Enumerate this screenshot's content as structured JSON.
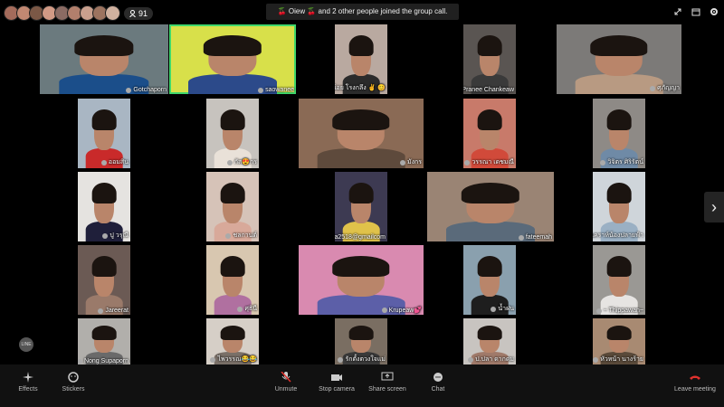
{
  "header": {
    "participant_count": "91",
    "notice_prefix": "Oiew",
    "notice_suffix": "and 2 other people joined the group call.",
    "avatars": [
      "#a46b5b",
      "#c18872",
      "#7b5846",
      "#d29a85",
      "#8b6b63",
      "#b27f6c",
      "#c9a08e",
      "#9c735f",
      "#d0b19f"
    ]
  },
  "tiles": [
    {
      "id": "t1",
      "name": "Gotchaporn",
      "bg": "#6b7a7e",
      "shirt": "#1b4e8a"
    },
    {
      "id": "t2",
      "name": "saowanee",
      "bg": "#d8e04a",
      "shirt": "#2c4a8a",
      "active": true
    },
    {
      "id": "t3",
      "name": "เจนน้อย โรงกลึง ✌ 😊",
      "bg": "#b9a9a0",
      "shirt": "#2b2b2b"
    },
    {
      "id": "t4",
      "name": "Pranee Chankeaw",
      "bg": "#5a5552",
      "shirt": "#3a3a3a"
    },
    {
      "id": "t5",
      "name": "ศุภัญญา",
      "bg": "#7c7a78",
      "shirt": "#b89a82"
    },
    {
      "id": "t6",
      "name": "ออมสิน",
      "bg": "#a9b6c3",
      "shirt": "#c92a2a"
    },
    {
      "id": "t7",
      "name": "กัส😍กร",
      "bg": "#c7c3be",
      "shirt": "#e9e1d8"
    },
    {
      "id": "t8",
      "name": "มังกร",
      "bg": "#8a6a55",
      "shirt": "#5e4a3c"
    },
    {
      "id": "t9",
      "name": "วรรณา เดชมณี",
      "bg": "#c87a6a",
      "shirt": "#d14a3a"
    },
    {
      "id": "t10",
      "name": "วิจิตร ศิริรัตน์",
      "bg": "#8e8a86",
      "shirt": "#6f8aa6"
    },
    {
      "id": "t11",
      "name": "ปู วรุณี",
      "bg": "#e5e3e0",
      "shirt": "#1f1f3a"
    },
    {
      "id": "t12",
      "name": "ชลกานต์",
      "bg": "#d6c3b8",
      "shirt": "#d8a99a"
    },
    {
      "id": "t13",
      "name": "Kochana2518@gmailcom",
      "bg": "#3d3a52",
      "shirt": "#e0c24a"
    },
    {
      "id": "t14",
      "name": "fateemah",
      "bg": "#9a8474",
      "shirt": "#5a6a7a"
    },
    {
      "id": "t15",
      "name": "ชมนคราห์น้องปลายฟ้า",
      "bg": "#cfd5da",
      "shirt": "#9ab0c4"
    },
    {
      "id": "t16",
      "name": "Jareerat",
      "bg": "#6b5a54",
      "shirt": "#9a7a6a"
    },
    {
      "id": "t17",
      "name": "ศุธินี",
      "bg": "#d8c7b0",
      "shirt": "#b070a0"
    },
    {
      "id": "t18",
      "name": "Krupeaw💕",
      "bg": "#d98ab0",
      "shirt": "#5c5fa8"
    },
    {
      "id": "t19",
      "name": "น้ำฝน",
      "bg": "#8aa0ae",
      "shirt": "#1e1e1e"
    },
    {
      "id": "t20",
      "name": "~ Thippawan~",
      "bg": "#9a9894",
      "shirt": "#e6e4e2"
    },
    {
      "id": "t21",
      "name": "Nong Supaporn",
      "bg": "#b1afab",
      "shirt": "#6a6a6a"
    },
    {
      "id": "t22",
      "name": "ไพวรรณ😂😂",
      "bg": "#d6cfc7",
      "shirt": "#7a7068"
    },
    {
      "id": "t23",
      "name": "รักตั้งตวงใจแม่",
      "bg": "#7a6e62",
      "shirt": "#3a3a3a"
    },
    {
      "id": "t24",
      "name": "ป.ปลา ดากดม",
      "bg": "#c8c4c0",
      "shirt": "#a07a6a"
    },
    {
      "id": "t25",
      "name": "หัวหน้า นางร้าย",
      "bg": "#a88a72",
      "shirt": "#5a4a3a"
    }
  ],
  "controls": {
    "effects": "Effects",
    "stickers": "Stickers",
    "unmute": "Unmute",
    "stop_camera": "Stop camera",
    "share_screen": "Share screen",
    "chat": "Chat",
    "leave": "Leave meeting"
  },
  "line_badge": "LINE",
  "colors": {
    "active_border": "#3fd76b",
    "leave": "#e0312d"
  }
}
